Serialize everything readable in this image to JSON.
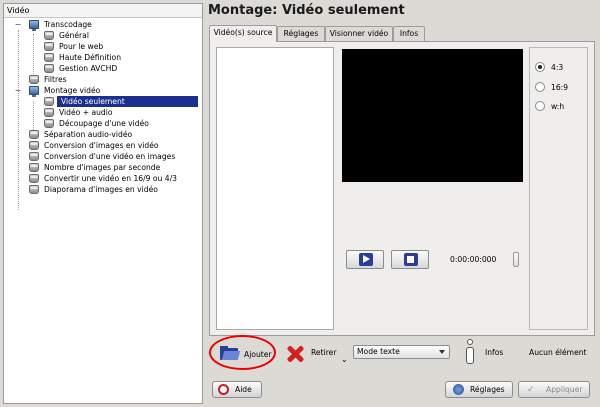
{
  "sidebar": {
    "header": "Vidéo",
    "items": [
      {
        "label": "Transcodage",
        "toggle": "−"
      },
      {
        "label": "Général"
      },
      {
        "label": "Pour le web"
      },
      {
        "label": "Haute Définition"
      },
      {
        "label": "Gestion AVCHD"
      },
      {
        "label": "Filtres"
      },
      {
        "label": "Montage vidéo",
        "toggle": "−"
      },
      {
        "label": "Vidéo seulement"
      },
      {
        "label": "Vidéo + audio"
      },
      {
        "label": "Découpage d'une vidéo"
      },
      {
        "label": "Séparation audio-vidéo"
      },
      {
        "label": "Conversion d'images en vidéo"
      },
      {
        "label": "Conversion d'une vidéo en images"
      },
      {
        "label": "Nombre d'images par seconde"
      },
      {
        "label": "Convertir une vidéo en 16/9 ou 4/3"
      },
      {
        "label": "Diaporama d'images en vidéo"
      }
    ]
  },
  "main": {
    "title": "Montage: Vidéo seulement",
    "tabs": [
      {
        "label": "Vidéo(s) source"
      },
      {
        "label": "Réglages"
      },
      {
        "label": "Visionner vidéo"
      },
      {
        "label": "Infos"
      }
    ],
    "ratio_options": [
      {
        "label": "4:3",
        "selected": true
      },
      {
        "label": "16:9",
        "selected": false
      },
      {
        "label": "w:h",
        "selected": false
      }
    ],
    "timecode": "0:00:00:000"
  },
  "actions": {
    "add_label": "Ajouter",
    "remove_label": "Retirer",
    "mode_selected": "Mode texte",
    "infos_label": "Infos",
    "status": "Aucun élément"
  },
  "footer": {
    "help_label": "Aide",
    "settings_label": "Réglages",
    "apply_label": "Appliquer"
  },
  "colors": {
    "selection": "#1c2f8e",
    "highlight_circle": "#e00000"
  }
}
